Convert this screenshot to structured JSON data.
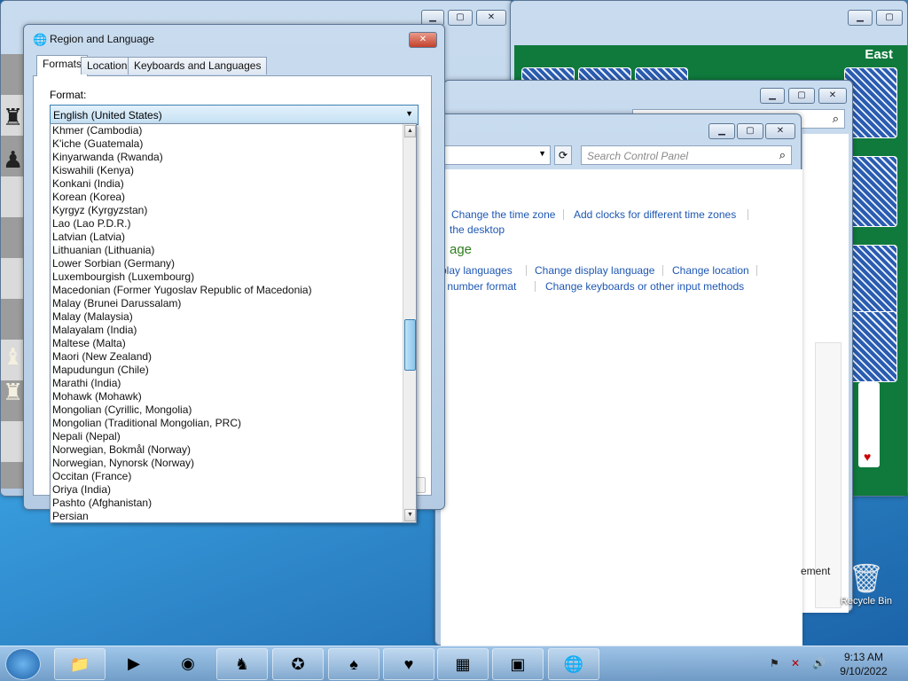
{
  "region_dialog": {
    "title": "Region and Language",
    "tabs": [
      "Formats",
      "Location",
      "Keyboards and Languages"
    ],
    "format_label": "Format:",
    "format_value": "English (United States)",
    "list_items": [
      "Khmer (Cambodia)",
      "K'iche (Guatemala)",
      "Kinyarwanda (Rwanda)",
      "Kiswahili (Kenya)",
      "Konkani (India)",
      "Korean (Korea)",
      "Kyrgyz (Kyrgyzstan)",
      "Lao (Lao P.D.R.)",
      "Latvian (Latvia)",
      "Lithuanian (Lithuania)",
      "Lower Sorbian (Germany)",
      "Luxembourgish (Luxembourg)",
      "Macedonian (Former Yugoslav Republic of Macedonia)",
      "Malay (Brunei Darussalam)",
      "Malay (Malaysia)",
      "Malayalam (India)",
      "Maltese (Malta)",
      "Maori (New Zealand)",
      "Mapudungun (Chile)",
      "Marathi (India)",
      "Mohawk (Mohawk)",
      "Mongolian (Cyrillic, Mongolia)",
      "Mongolian (Traditional Mongolian, PRC)",
      "Nepali (Nepal)",
      "Norwegian, Bokmål (Norway)",
      "Norwegian, Nynorsk (Norway)",
      "Occitan (France)",
      "Oriya (India)",
      "Pashto (Afghanistan)",
      "Persian"
    ]
  },
  "control_panel": {
    "search_placeholder": "Search Control Panel",
    "links": {
      "change_time_zone": "Change the time zone",
      "add_clocks": "Add clocks for different time zones",
      "the_desktop": "the desktop",
      "heading_fragment": "age",
      "display_languages": "play languages",
      "change_display_language": "Change display language",
      "change_location": "Change location",
      "number_format": "r number format",
      "change_keyboards": "Change keyboards or other input methods"
    },
    "bottom_fragment": "ement"
  },
  "solitaire": {
    "label": "East"
  },
  "desktop": {
    "recycle_bin_label": "Recycle Bin"
  },
  "taskbar": {
    "clock_time": "9:13 AM",
    "clock_date": "9/10/2022"
  }
}
